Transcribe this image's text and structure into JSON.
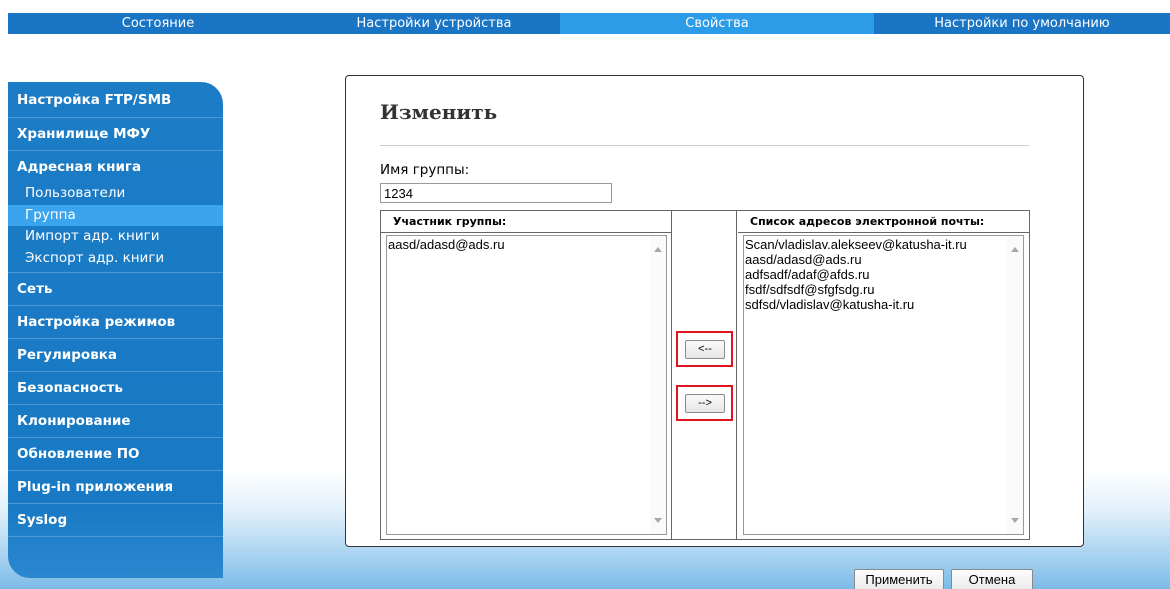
{
  "topnav": {
    "tabs": [
      {
        "label": "Состояние"
      },
      {
        "label": "Настройки устройства"
      },
      {
        "label": "Свойства"
      },
      {
        "label": "Настройки по умолчанию"
      }
    ],
    "active_index": 2
  },
  "sidebar": {
    "items": [
      {
        "label": "Настройка FTP/SMB"
      },
      {
        "label": "Хранилище МФУ"
      },
      {
        "label": "Адресная книга"
      },
      {
        "label": "Сеть"
      },
      {
        "label": "Настройка режимов"
      },
      {
        "label": "Регулировка"
      },
      {
        "label": "Безопасность"
      },
      {
        "label": "Клонирование"
      },
      {
        "label": "Обновление ПО"
      },
      {
        "label": "Plug-in приложения"
      },
      {
        "label": "Syslog"
      }
    ],
    "address_book_subitems": [
      {
        "label": "Пользователи"
      },
      {
        "label": "Группа"
      },
      {
        "label": "Импорт адр. книги"
      },
      {
        "label": "Экспорт адр. книги"
      }
    ],
    "active_subitem": "Группа"
  },
  "panel": {
    "title": "Изменить",
    "group_name_label": "Имя группы:",
    "group_name_value": "1234",
    "members_header": "Участник группы:",
    "members": [
      "aasd/adasd@ads.ru"
    ],
    "emails_header": "Список адресов электронной почты:",
    "emails": [
      "Scan/vladislav.alekseev@katusha-it.ru",
      "aasd/adasd@ads.ru",
      "adfsadf/adaf@afds.ru",
      "fsdf/sdfsdf@sfgfsdg.ru",
      "sdfsd/vladislav@katusha-it.ru"
    ],
    "move_left_label": "<--",
    "move_right_label": "-->",
    "highlight_color": "#e0141e"
  },
  "actions": {
    "apply_label": "Применить",
    "cancel_label": "Отмена"
  },
  "colors": {
    "nav_blue": "#1a76c4",
    "nav_active": "#2c9be8",
    "sidebar_active": "#3aa4ee"
  }
}
